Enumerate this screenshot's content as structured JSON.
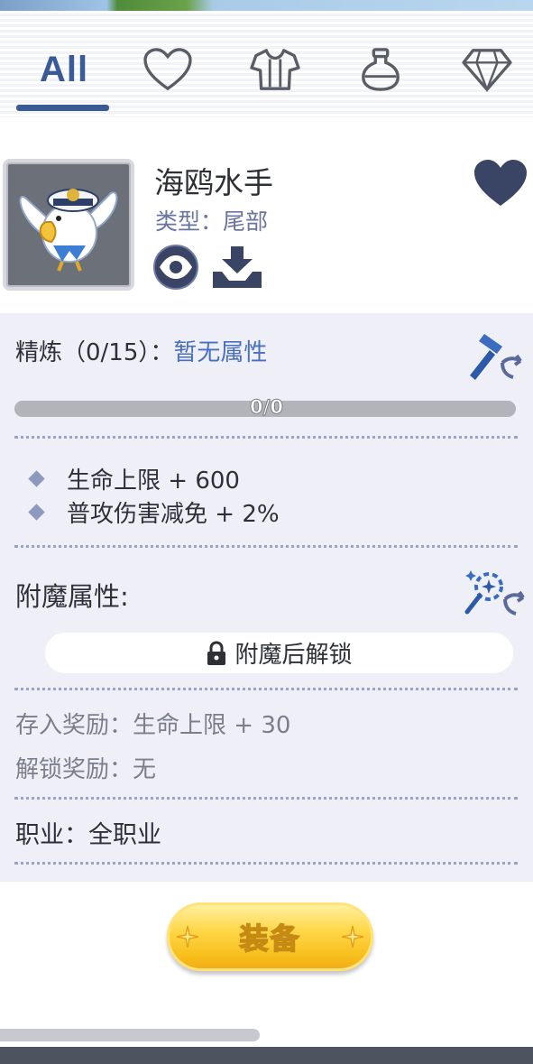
{
  "tabs": [
    {
      "label": "All",
      "selected": true
    },
    {
      "icon": "heart-outline-icon"
    },
    {
      "icon": "shirt-icon"
    },
    {
      "icon": "potion-icon"
    },
    {
      "icon": "diamond-icon"
    }
  ],
  "item": {
    "name": "海鸥水手",
    "type": "类型：尾部",
    "favorited": true
  },
  "refine": {
    "label": "精炼（0/15）：",
    "value": "暂无属性",
    "progress_text": "0/0",
    "progress": 0
  },
  "stats": [
    "生命上限 + 600",
    "普攻伤害减免 + 2%"
  ],
  "enchant": {
    "title": "附魔属性:",
    "locked_text": "附魔后解锁"
  },
  "rewards": {
    "store": "存入奖励：生命上限 + 30",
    "unlock": "解锁奖励：无"
  },
  "job": "职业：全职业",
  "equip_label": "装备",
  "colors": {
    "accent": "#3a5a98",
    "link": "#4a6fc0",
    "button": "#ffd84a"
  }
}
